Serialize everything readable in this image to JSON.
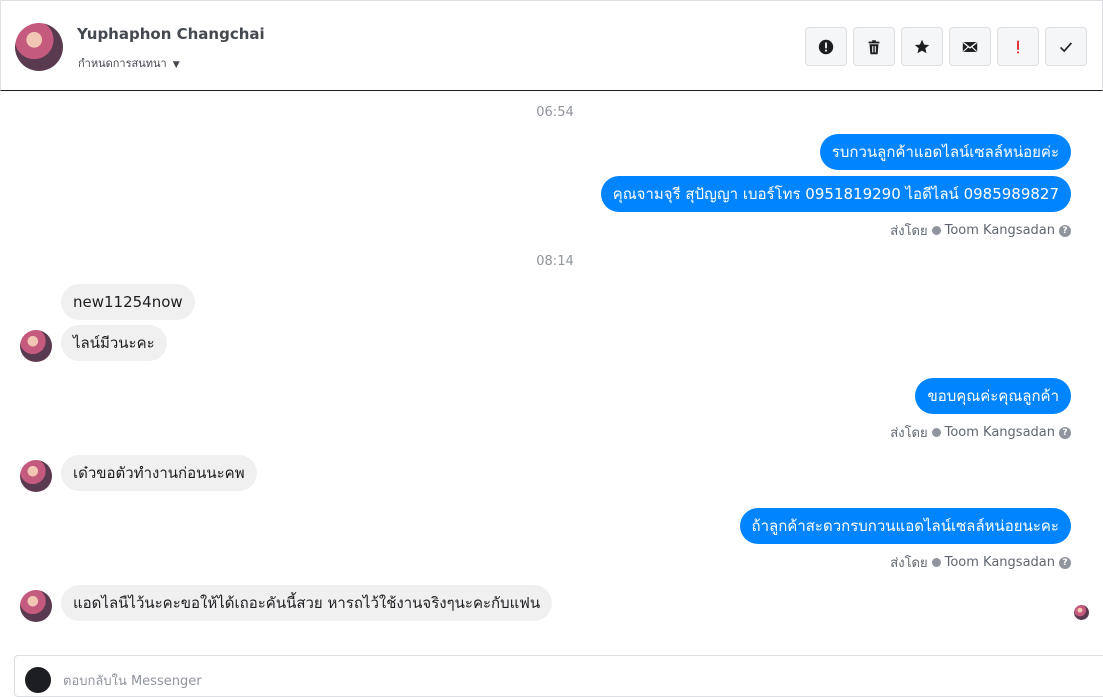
{
  "header": {
    "contact_name": "Yuphaphon Changchai",
    "assign_label": "กำหนดการสนทนา",
    "toolbar": [
      {
        "icon": "alert-circle-icon"
      },
      {
        "icon": "trash-icon"
      },
      {
        "icon": "star-icon"
      },
      {
        "icon": "envelope-icon"
      },
      {
        "icon": "exclamation-icon"
      },
      {
        "icon": "checkmark-icon"
      }
    ]
  },
  "thread": {
    "timestamps": [
      "06:54",
      "08:14"
    ],
    "messages": [
      {
        "dir": "out",
        "text": "รบกวนลูกค้าแอดไลน์เซลล์หน่อยค่ะ"
      },
      {
        "dir": "out",
        "text": "คุณจามจุรี สุปัญญา เบอร์โทร 0951819290  ไอดีไลน์ 0985989827"
      },
      {
        "dir": "in",
        "text": "new11254now"
      },
      {
        "dir": "in",
        "text": "ไลน์มีวนะคะ"
      },
      {
        "dir": "out",
        "text": "ขอบคุณค่ะคุณลูกค้า"
      },
      {
        "dir": "in",
        "text": "เด๋วขอตัวทำงานก่อนนะคพ"
      },
      {
        "dir": "out",
        "text": "ถ้าลูกค้าสะดวกรบกวนแอดไลน์เซลล์หน่อยนะคะ"
      },
      {
        "dir": "in",
        "text": "แอดไลนืไว้นะคะขอให้ได้เถอะคันนี้สวย หารถไว้ใช้งานจริงๆนะคะกับแฟน"
      }
    ],
    "sent_by_prefix": "ส่งโดย",
    "sent_by_name": "Toom Kangsadan"
  },
  "reply": {
    "placeholder": "ตอบกลับใน Messenger"
  },
  "colors": {
    "outgoing_bubble": "#0084ff",
    "incoming_bubble": "#f1f0f0"
  }
}
